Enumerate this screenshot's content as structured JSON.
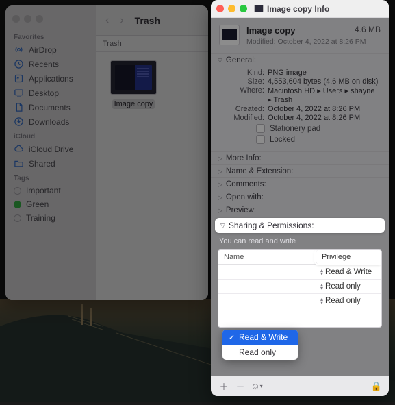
{
  "finder": {
    "title": "Trash",
    "path": "Trash",
    "sidebar": {
      "favorites_label": "Favorites",
      "items": [
        {
          "label": "AirDrop"
        },
        {
          "label": "Recents"
        },
        {
          "label": "Applications"
        },
        {
          "label": "Desktop"
        },
        {
          "label": "Documents"
        },
        {
          "label": "Downloads"
        }
      ],
      "icloud_label": "iCloud",
      "icloud_items": [
        {
          "label": "iCloud Drive"
        },
        {
          "label": "Shared"
        }
      ],
      "tags_label": "Tags",
      "tags": [
        {
          "label": "Important"
        },
        {
          "label": "Green"
        },
        {
          "label": "Training"
        }
      ]
    },
    "file_label": "Image copy"
  },
  "info": {
    "window_title": "Image copy Info",
    "name": "Image copy",
    "size": "4.6 MB",
    "modified_line": "Modified: October 4, 2022 at 8:26 PM",
    "general_label": "General:",
    "kv": {
      "kind_k": "Kind:",
      "kind_v": "PNG image",
      "size_k": "Size:",
      "size_v": "4,553,604 bytes (4.6 MB on disk)",
      "where_k": "Where:",
      "where_v": "Macintosh HD ▸ Users ▸ shayne ▸ Trash",
      "created_k": "Created:",
      "created_v": "October 4, 2022 at 8:26 PM",
      "mod_k": "Modified:",
      "mod_v": "October 4, 2022 at 8:26 PM"
    },
    "stationery_label": "Stationery pad",
    "locked_label": "Locked",
    "rows": {
      "more": "More Info:",
      "nameext": "Name & Extension:",
      "comments": "Comments:",
      "openwith": "Open with:",
      "preview": "Preview:",
      "sharing": "Sharing & Permissions:"
    },
    "sp_note": "You can read and write",
    "table": {
      "col_name": "Name",
      "col_priv": "Privilege",
      "priv1": "Read & Write",
      "priv2": "Read only",
      "priv3": "Read only"
    },
    "popup": {
      "opt_sel": "Read & Write",
      "opt2": "Read only"
    }
  }
}
